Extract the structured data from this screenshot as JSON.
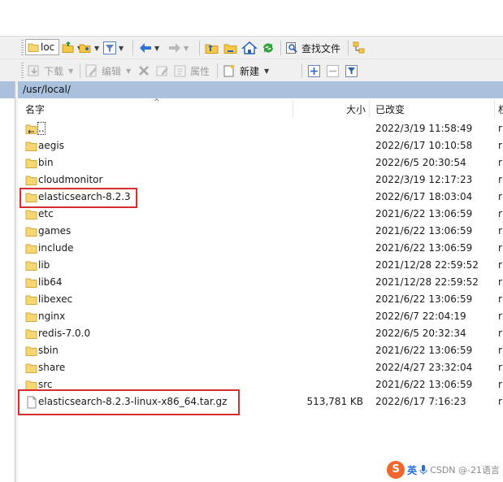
{
  "toolbar1": {
    "location_combo": "loc",
    "find_files_label": "查找文件"
  },
  "toolbar2": {
    "download_label": "下载",
    "edit_label": "编辑",
    "properties_label": "属性",
    "new_label": "新建"
  },
  "path_bar": {
    "path": "/usr/local/"
  },
  "columns": {
    "name": "名字",
    "size": "大小",
    "modified": "已改变",
    "perm": "权"
  },
  "files": [
    {
      "name": "..",
      "size": "",
      "modified": "2022/3/19 11:58:49",
      "perm": "r",
      "type": "parent"
    },
    {
      "name": "aegis",
      "size": "",
      "modified": "2022/6/17 10:10:58",
      "perm": "r",
      "type": "folder"
    },
    {
      "name": "bin",
      "size": "",
      "modified": "2022/6/5 20:30:54",
      "perm": "r",
      "type": "folder"
    },
    {
      "name": "cloudmonitor",
      "size": "",
      "modified": "2022/3/19 12:17:23",
      "perm": "r",
      "type": "folder"
    },
    {
      "name": "elasticsearch-8.2.3",
      "size": "",
      "modified": "2022/6/17 18:03:04",
      "perm": "r",
      "type": "folder"
    },
    {
      "name": "etc",
      "size": "",
      "modified": "2021/6/22 13:06:59",
      "perm": "r",
      "type": "folder"
    },
    {
      "name": "games",
      "size": "",
      "modified": "2021/6/22 13:06:59",
      "perm": "r",
      "type": "folder"
    },
    {
      "name": "include",
      "size": "",
      "modified": "2021/6/22 13:06:59",
      "perm": "r",
      "type": "folder"
    },
    {
      "name": "lib",
      "size": "",
      "modified": "2021/12/28 22:59:52",
      "perm": "r",
      "type": "folder"
    },
    {
      "name": "lib64",
      "size": "",
      "modified": "2021/12/28 22:59:52",
      "perm": "r",
      "type": "folder"
    },
    {
      "name": "libexec",
      "size": "",
      "modified": "2021/6/22 13:06:59",
      "perm": "r",
      "type": "folder"
    },
    {
      "name": "nginx",
      "size": "",
      "modified": "2022/6/7 22:04:19",
      "perm": "r",
      "type": "folder"
    },
    {
      "name": "redis-7.0.0",
      "size": "",
      "modified": "2022/6/5 20:32:34",
      "perm": "r",
      "type": "folder"
    },
    {
      "name": "sbin",
      "size": "",
      "modified": "2021/6/22 13:06:59",
      "perm": "r",
      "type": "folder"
    },
    {
      "name": "share",
      "size": "",
      "modified": "2022/4/27 23:32:04",
      "perm": "r",
      "type": "folder"
    },
    {
      "name": "src",
      "size": "",
      "modified": "2021/6/22 13:06:59",
      "perm": "r",
      "type": "folder"
    },
    {
      "name": "elasticsearch-8.2.3-linux-x86_64.tar.gz",
      "size": "513,781 KB",
      "modified": "2022/6/17 7:16:23",
      "perm": "r",
      "type": "file"
    }
  ],
  "watermark": {
    "ime": "英",
    "text": "CSDN @-21语言"
  },
  "colors": {
    "path_bar": "#a9c1dc",
    "folder": "#f7d774",
    "highlight": "#d62e2e"
  }
}
